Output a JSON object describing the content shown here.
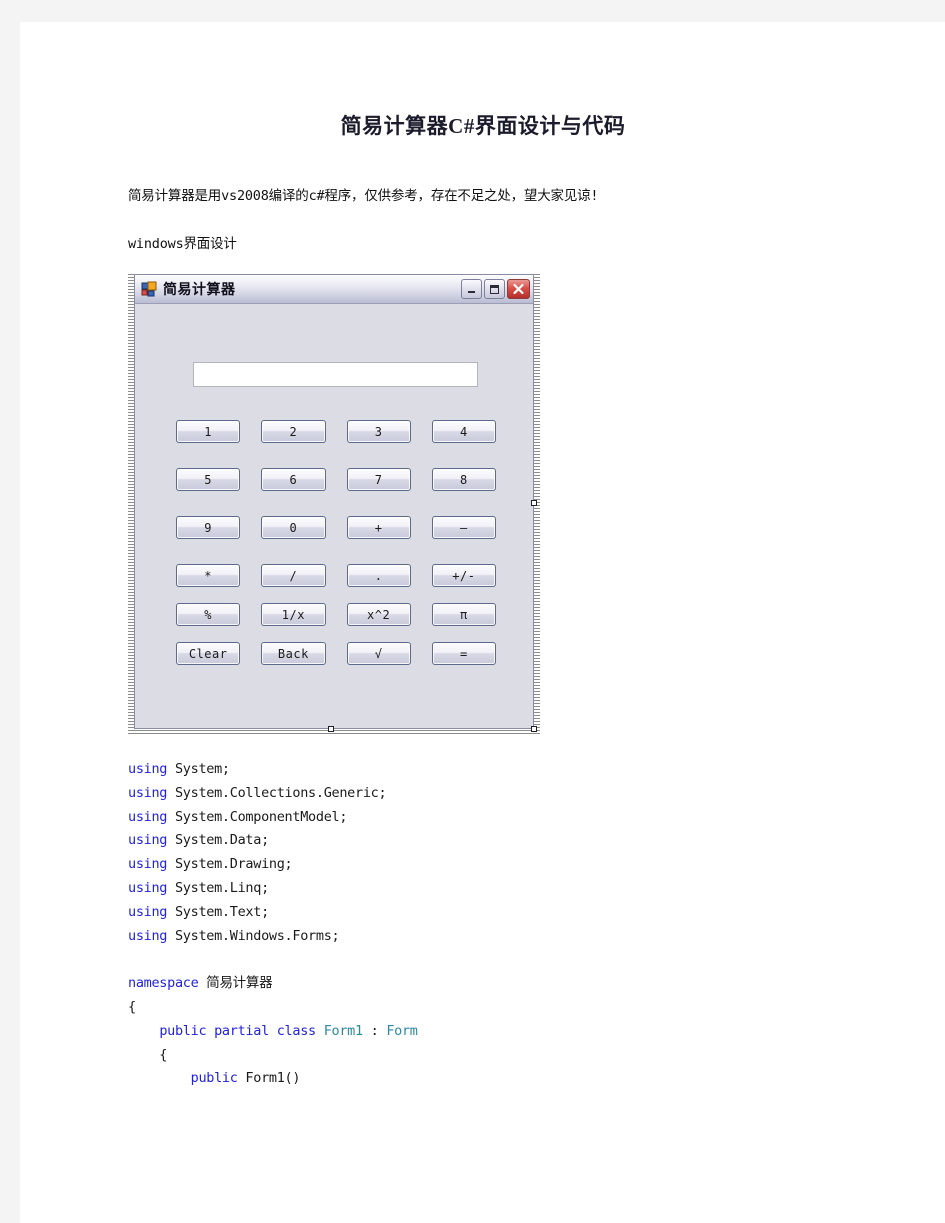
{
  "document": {
    "title": "简易计算器C#界面设计与代码",
    "paragraphs": [
      "简易计算器是用vs2008编译的c#程序，仅供参考，存在不足之处，望大家见谅!",
      "windows界面设计"
    ]
  },
  "calculator_form": {
    "titlebar": {
      "text": "简易计算器",
      "icon": "windows-form-icon",
      "minimize_glyph": "_",
      "maximize_glyph": "❐",
      "close_glyph": "✕"
    },
    "display": {
      "value": "",
      "placeholder": ""
    },
    "buttons": [
      [
        "1",
        "2",
        "3",
        "4"
      ],
      [
        "5",
        "6",
        "7",
        "8"
      ],
      [
        "9",
        "0",
        "+",
        "–"
      ],
      [
        "*",
        "/",
        ".",
        "+/-"
      ],
      [
        "%",
        "1/x",
        "x^2",
        "π"
      ],
      [
        "Clear",
        "Back",
        "√",
        "="
      ]
    ]
  },
  "code_listing": {
    "lines": [
      {
        "parts": [
          {
            "t": "using",
            "c": "kw"
          },
          {
            "t": " System;",
            "c": ""
          }
        ]
      },
      {
        "parts": [
          {
            "t": "using",
            "c": "kw"
          },
          {
            "t": " System.Collections.Generic;",
            "c": ""
          }
        ]
      },
      {
        "parts": [
          {
            "t": "using",
            "c": "kw"
          },
          {
            "t": " System.ComponentModel;",
            "c": ""
          }
        ]
      },
      {
        "parts": [
          {
            "t": "using",
            "c": "kw"
          },
          {
            "t": " System.Data;",
            "c": ""
          }
        ]
      },
      {
        "parts": [
          {
            "t": "using",
            "c": "kw"
          },
          {
            "t": " System.Drawing;",
            "c": ""
          }
        ]
      },
      {
        "parts": [
          {
            "t": "using",
            "c": "kw"
          },
          {
            "t": " System.Linq;",
            "c": ""
          }
        ]
      },
      {
        "parts": [
          {
            "t": "using",
            "c": "kw"
          },
          {
            "t": " System.Text;",
            "c": ""
          }
        ]
      },
      {
        "parts": [
          {
            "t": "using",
            "c": "kw"
          },
          {
            "t": " System.Windows.Forms;",
            "c": ""
          }
        ]
      },
      {
        "parts": [
          {
            "t": "",
            "c": ""
          }
        ]
      },
      {
        "parts": [
          {
            "t": "namespace",
            "c": "kw"
          },
          {
            "t": " 简易计算器",
            "c": ""
          }
        ]
      },
      {
        "parts": [
          {
            "t": "{",
            "c": ""
          }
        ]
      },
      {
        "parts": [
          {
            "t": "    ",
            "c": ""
          },
          {
            "t": "public partial class",
            "c": "kw"
          },
          {
            "t": " ",
            "c": ""
          },
          {
            "t": "Form1",
            "c": "ty"
          },
          {
            "t": " : ",
            "c": ""
          },
          {
            "t": "Form",
            "c": "ty"
          }
        ]
      },
      {
        "parts": [
          {
            "t": "    {",
            "c": ""
          }
        ]
      },
      {
        "parts": [
          {
            "t": "        ",
            "c": ""
          },
          {
            "t": "public",
            "c": "kw"
          },
          {
            "t": " Form1()",
            "c": ""
          }
        ]
      }
    ]
  },
  "colors": {
    "page_margin": "#f4f4f4",
    "form_face": "#dcdce4",
    "button_border": "#5d6a8c",
    "keyword_blue": "#2222dd",
    "type_teal": "#2b8a9e",
    "close_red": "#d9504a"
  }
}
